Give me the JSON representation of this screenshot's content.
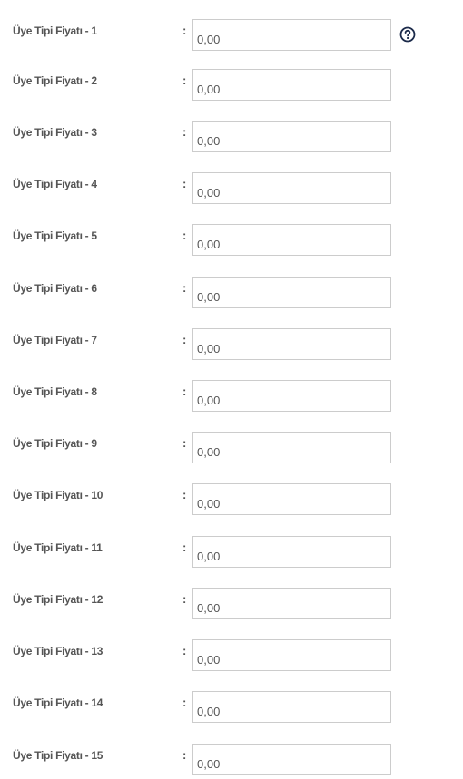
{
  "colon": ":",
  "help": {
    "icon": "question-circle-icon",
    "color": "#1b2a4a"
  },
  "fields": [
    {
      "label": "Üye Tipi Fiyatı - 1",
      "value": "0,00"
    },
    {
      "label": "Üye Tipi Fiyatı - 2",
      "value": "0,00"
    },
    {
      "label": "Üye Tipi Fiyatı - 3",
      "value": "0,00"
    },
    {
      "label": "Üye Tipi Fiyatı - 4",
      "value": "0,00"
    },
    {
      "label": "Üye Tipi Fiyatı - 5",
      "value": "0,00"
    },
    {
      "label": "Üye Tipi Fiyatı - 6",
      "value": "0,00"
    },
    {
      "label": "Üye Tipi Fiyatı - 7",
      "value": "0,00"
    },
    {
      "label": "Üye Tipi Fiyatı - 8",
      "value": "0,00"
    },
    {
      "label": "Üye Tipi Fiyatı - 9",
      "value": "0,00"
    },
    {
      "label": "Üye Tipi Fiyatı - 10",
      "value": "0,00"
    },
    {
      "label": "Üye Tipi Fiyatı - 11",
      "value": "0,00"
    },
    {
      "label": "Üye Tipi Fiyatı - 12",
      "value": "0,00"
    },
    {
      "label": "Üye Tipi Fiyatı - 13",
      "value": "0,00"
    },
    {
      "label": "Üye Tipi Fiyatı - 14",
      "value": "0,00"
    },
    {
      "label": "Üye Tipi Fiyatı - 15",
      "value": "0,00"
    }
  ]
}
